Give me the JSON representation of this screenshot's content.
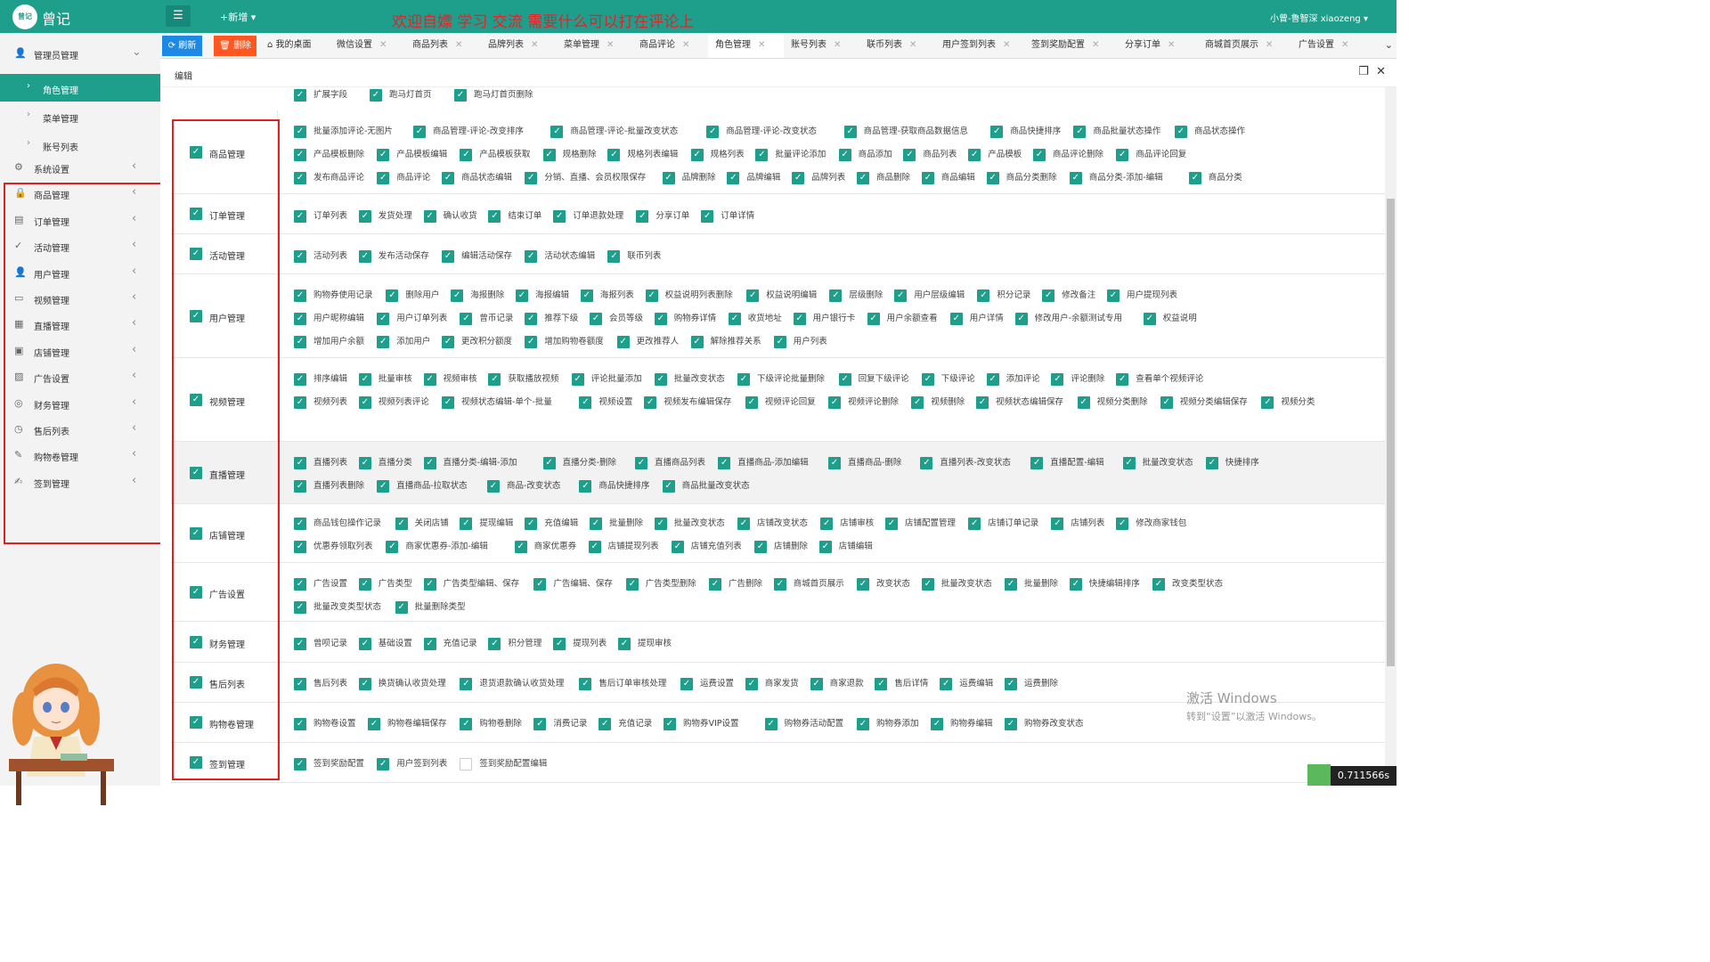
{
  "header": {
    "logo_text": "曾记",
    "app_name": "曾记",
    "new_label": "+新增",
    "banner": "欢迎自嫖 学习 交流 需要什么可以打在评论上",
    "user": "小曾-鲁智深 xiaozeng"
  },
  "sidebar": {
    "top_item": "管理员管理",
    "sub_items": [
      "角色管理",
      "菜单管理",
      "账号列表"
    ],
    "items": [
      "系统设置",
      "商品管理",
      "订单管理",
      "活动管理",
      "用户管理",
      "视频管理",
      "直播管理",
      "店铺管理",
      "广告设置",
      "财务管理",
      "售后列表",
      "购物卷管理",
      "签到管理"
    ]
  },
  "toolbar": {
    "refresh": "刷新",
    "delete": "删除"
  },
  "tabs": [
    "我的桌面",
    "微信设置",
    "商品列表",
    "品牌列表",
    "菜单管理",
    "商品评论",
    "角色管理",
    "账号列表",
    "联币列表",
    "用户签到列表",
    "签到奖励配置",
    "分享订单",
    "商城首页展示",
    "广告设置"
  ],
  "page_title": "编辑",
  "groups": [
    {
      "name": "商品管理",
      "perms": [
        "批量添加评论-无图片",
        "商品管理-评论-改变排序",
        "商品管理-评论-批量改变状态",
        "商品管理-评论-改变状态",
        "商品管理-获取商品数据信息",
        "商品快捷排序",
        "商品批量状态操作",
        "商品状态操作",
        "产品模板删除",
        "产品模板编辑",
        "产品模板获取",
        "规格删除",
        "规格列表编辑",
        "规格列表",
        "批量评论添加",
        "商品添加",
        "商品列表",
        "产品模板",
        "商品评论删除",
        "商品评论回复",
        "发布商品评论",
        "商品评论",
        "商品状态编辑",
        "分销、直播、会员权限保存",
        "品牌删除",
        "品牌编辑",
        "品牌列表",
        "商品删除",
        "商品编辑",
        "商品分类删除",
        "商品分类-添加-编辑",
        "商品分类"
      ]
    },
    {
      "name": "订单管理",
      "perms": [
        "订单列表",
        "发货处理",
        "确认收货",
        "结束订单",
        "订单退款处理",
        "分享订单",
        "订单详情"
      ]
    },
    {
      "name": "活动管理",
      "perms": [
        "活动列表",
        "发布活动保存",
        "编辑活动保存",
        "活动状态编辑",
        "联币列表"
      ]
    },
    {
      "name": "用户管理",
      "perms": [
        "购物券使用记录",
        "删除用户",
        "海报删除",
        "海报编辑",
        "海报列表",
        "权益说明列表删除",
        "权益说明编辑",
        "层级删除",
        "用户层级编辑",
        "积分记录",
        "修改备注",
        "用户提现列表",
        "用户昵称编辑",
        "用户订单列表",
        "曾币记录",
        "推荐下级",
        "会员等级",
        "购物券详情",
        "收货地址",
        "用户银行卡",
        "用户余额查看",
        "用户详情",
        "修改用户-余额测试专用",
        "权益说明",
        "增加用户余额",
        "添加用户",
        "更改积分额度",
        "增加购物卷额度",
        "更改推荐人",
        "解除推荐关系",
        "用户列表"
      ]
    },
    {
      "name": "视频管理",
      "perms": [
        "排序编辑",
        "批量审核",
        "视频审核",
        "获取播放视频",
        "评论批量添加",
        "批量改变状态",
        "下级评论批量删除",
        "回复下级评论",
        "下级评论",
        "添加评论",
        "评论删除",
        "查看单个视频评论",
        "视频列表",
        "视频列表评论",
        "视频状态编辑-单个-批量",
        "视频设置",
        "视频发布编辑保存",
        "视频评论回复",
        "视频评论删除",
        "视频删除",
        "视频状态编辑保存",
        "视频分类删除",
        "视频分类编辑保存",
        "视频分类"
      ]
    },
    {
      "name": "直播管理",
      "perms": [
        "直播列表",
        "直播分类",
        "直播分类-编辑-添加",
        "直播分类-删除",
        "直播商品列表",
        "直播商品-添加编辑",
        "直播商品-删除",
        "直播列表-改变状态",
        "直播配置-编辑",
        "批量改变状态",
        "快捷排序",
        "直播列表删除",
        "直播商品-拉取状态",
        "商品-改变状态",
        "商品快捷排序",
        "商品批量改变状态"
      ]
    },
    {
      "name": "店铺管理",
      "perms": [
        "商品钱包操作记录",
        "关闭店铺",
        "提现编辑",
        "充值编辑",
        "批量删除",
        "批量改变状态",
        "店铺改变状态",
        "店铺审核",
        "店铺配置管理",
        "店铺订单记录",
        "店铺列表",
        "修改商家钱包",
        "优惠券领取列表",
        "商家优惠券-添加-编辑",
        "商家优惠券",
        "店铺提现列表",
        "店铺充值列表",
        "店铺删除",
        "店铺编辑"
      ]
    },
    {
      "name": "广告设置",
      "perms": [
        "广告设置",
        "广告类型",
        "广告类型编辑、保存",
        "广告编辑、保存",
        "广告类型删除",
        "广告删除",
        "商城首页展示",
        "改变状态",
        "批量改变状态",
        "批量删除",
        "快捷编辑排序",
        "改变类型状态",
        "批量改变类型状态",
        "批量删除类型"
      ]
    },
    {
      "name": "财务管理",
      "perms": [
        "曾呗记录",
        "基础设置",
        "充值记录",
        "积分管理",
        "提现列表",
        "提现审核"
      ]
    },
    {
      "name": "售后列表",
      "perms": [
        "售后列表",
        "换货确认收货处理",
        "退货退款确认收货处理",
        "售后订单审核处理",
        "运费设置",
        "商家发货",
        "商家退款",
        "售后详情",
        "运费编辑",
        "运费删除"
      ]
    },
    {
      "name": "购物卷管理",
      "perms": [
        "购物卷设置",
        "购物卷编辑保存",
        "购物卷删除",
        "消费记录",
        "充值记录",
        "购物券VIP设置",
        "购物券活动配置",
        "购物券添加",
        "购物券编辑",
        "购物券改变状态"
      ]
    },
    {
      "name": "签到管理",
      "perms": [
        "签到奖励配置",
        "用户签到列表",
        "签到奖励配置编辑"
      ],
      "unchecked": [
        2
      ]
    }
  ],
  "partial_top": [
    "扩展字段",
    "跑马灯首页",
    "跑马灯首页删除"
  ],
  "watermark": {
    "line1": "激活 Windows",
    "line2": "转到“设置”以激活 Windows。"
  },
  "timer": "0.711566s"
}
